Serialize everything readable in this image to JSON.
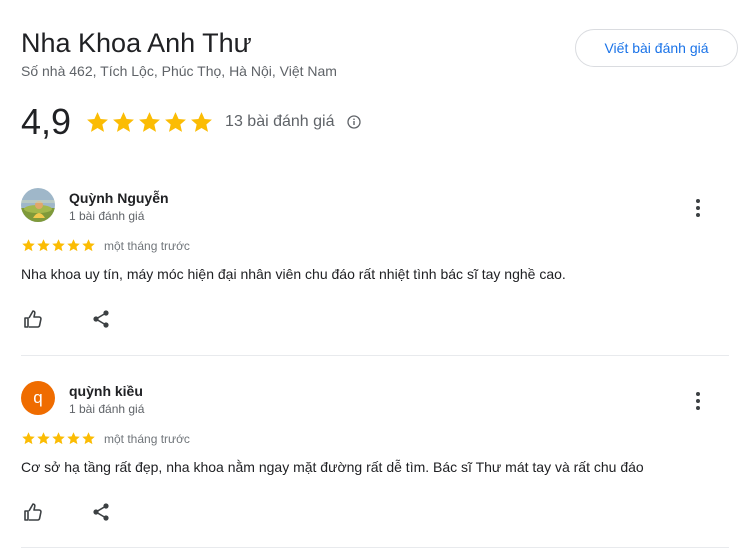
{
  "place": {
    "name": "Nha Khoa Anh Thư",
    "address": "Số nhà 462, Tích Lộc, Phúc Thọ, Hà Nội, Việt Nam"
  },
  "write_review_label": "Viết bài đánh giá",
  "summary": {
    "score": "4,9",
    "stars": 5,
    "review_count": "13 bài đánh giá"
  },
  "colors": {
    "star": "#fbbc04",
    "accent": "#1a73e8",
    "avatar_q": "#ef6c00"
  },
  "reviews": [
    {
      "author": "Quỳnh Nguyễn",
      "meta": "1 bài đánh giá",
      "stars": 5,
      "time": "một tháng trước",
      "text": "Nha khoa uy tín, máy móc hiện đại nhân viên chu đáo rất nhiệt tình bác sĩ tay nghề cao.",
      "avatar": "photo-avatar"
    },
    {
      "author": "quỳnh kiều",
      "meta": "1 bài đánh giá",
      "stars": 5,
      "time": "một tháng trước",
      "text": "Cơ sở hạ tầng rất đẹp, nha khoa nằm ngay mặt đường rất dễ tìm. Bác sĩ Thư mát tay và rất chu đáo",
      "avatar_letter": "q"
    }
  ]
}
